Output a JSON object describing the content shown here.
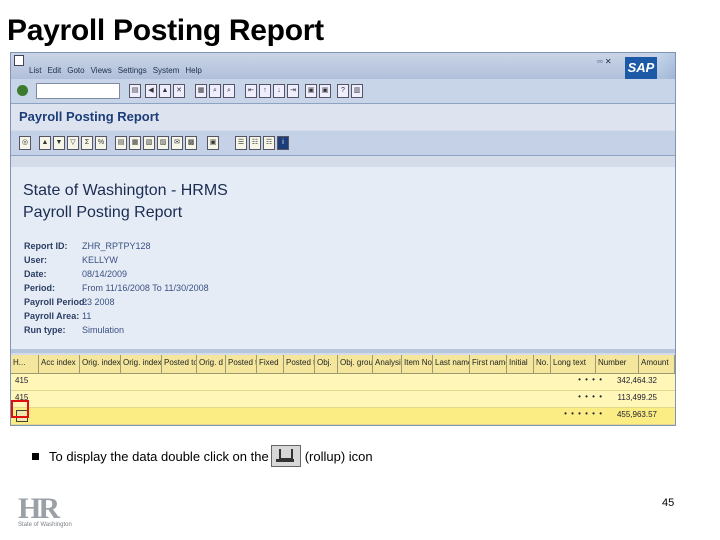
{
  "slide": {
    "title": "Payroll Posting Report",
    "bullet_before": "To display the data double click on the",
    "bullet_after": "(rollup) icon",
    "page_number": "45"
  },
  "logo": {
    "text": "HR",
    "subtext": "State of Washington"
  },
  "sap": {
    "menu": [
      "List",
      "Edit",
      "Goto",
      "Views",
      "Settings",
      "System",
      "Help"
    ],
    "brand": "SAP",
    "window_title": "Payroll Posting Report",
    "report_heading_1": "State of Washington - HRMS",
    "report_heading_2": "Payroll Posting Report",
    "fields": [
      {
        "label": "Report ID:",
        "value": "ZHR_RPTPY128"
      },
      {
        "label": "User:",
        "value": "KELLYW"
      },
      {
        "label": "Date:",
        "value": "08/14/2009"
      },
      {
        "label": "Period:",
        "value": "From 11/16/2008 To 11/30/2008"
      },
      {
        "label": "Payroll Period:",
        "value": "23 2008"
      },
      {
        "label": "Payroll Area:",
        "value": "11"
      },
      {
        "label": "Run type:",
        "value": "Simulation"
      }
    ],
    "grid_headers": [
      "H...",
      "Acc index",
      "Orig. index",
      "Orig. index",
      "Posted to",
      "Orig. d",
      "Posted to",
      "Fixed",
      "Posted to",
      "Obj.",
      "Obj. group",
      "Analysis",
      "Item No.",
      "Last name",
      "First name",
      "Initial",
      "No.",
      "Long text",
      "Number",
      "Amount"
    ],
    "rows": [
      {
        "index": "415",
        "dots": "• • • •",
        "amount": "342,464.32"
      },
      {
        "index": "415",
        "dots": "• • • •",
        "amount": "113,499.25"
      },
      {
        "index": "",
        "dots": "• • • • • •",
        "amount": "455,963.57"
      }
    ]
  }
}
